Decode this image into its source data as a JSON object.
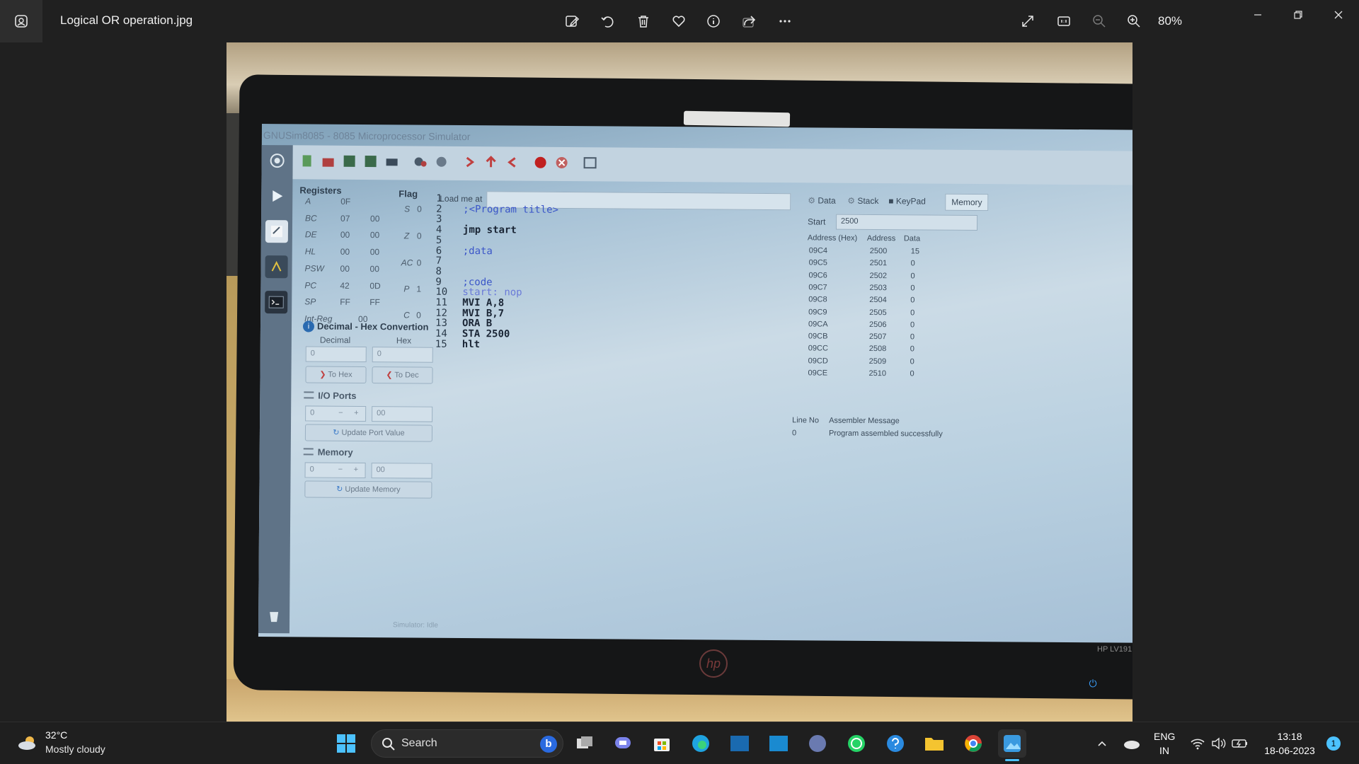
{
  "window": {
    "file_title": "Logical OR operation.jpg",
    "zoom": "80%"
  },
  "colors": {
    "titlebar": "#202020",
    "accent": "#4cc2ff",
    "taskbar": "#1f1f1f"
  },
  "photo": {
    "sim_title": "GNUSim8085 - 8085 Microprocessor Simulator",
    "registers_title": "Registers",
    "flag_title": "Flag",
    "registers": [
      {
        "name": "A",
        "v1": "0F",
        "v2": ""
      },
      {
        "name": "BC",
        "v1": "07",
        "v2": "00"
      },
      {
        "name": "DE",
        "v1": "00",
        "v2": "00"
      },
      {
        "name": "HL",
        "v1": "00",
        "v2": "00"
      },
      {
        "name": "PSW",
        "v1": "00",
        "v2": "00"
      },
      {
        "name": "PC",
        "v1": "42",
        "v2": "0D"
      },
      {
        "name": "SP",
        "v1": "FF",
        "v2": "FF"
      },
      {
        "name": "Int-Reg",
        "v1": "00",
        "v2": ""
      }
    ],
    "flags": [
      {
        "name": "S",
        "value": "0"
      },
      {
        "name": "Z",
        "value": "0"
      },
      {
        "name": "AC",
        "value": "0"
      },
      {
        "name": "P",
        "value": "1"
      },
      {
        "name": "C",
        "value": "0"
      }
    ],
    "converter": {
      "title": "Decimal - Hex Convertion",
      "decimal_label": "Decimal",
      "hex_label": "Hex",
      "decimal_value": "0",
      "hex_value": "0",
      "to_hex": "To Hex",
      "to_dec": "To Dec"
    },
    "io_ports": {
      "title": "I/O Ports",
      "port": "0",
      "value": "00",
      "minus": "−",
      "plus": "+",
      "update": "Update Port Value"
    },
    "memory_box": {
      "title": "Memory",
      "address": "0",
      "value": "00",
      "minus": "−",
      "plus": "+",
      "update": "Update Memory"
    },
    "load_label": "Load me at",
    "code_lines": [
      {
        "n": "1",
        "text": ""
      },
      {
        "n": "2",
        "text": ";<Program title>"
      },
      {
        "n": "3",
        "text": ""
      },
      {
        "n": "4",
        "text": "jmp start"
      },
      {
        "n": "5",
        "text": ""
      },
      {
        "n": "6",
        "text": ";data"
      },
      {
        "n": "7",
        "text": ""
      },
      {
        "n": "8",
        "text": ""
      },
      {
        "n": "9",
        "text": ";code"
      },
      {
        "n": "10",
        "text": "start: nop"
      },
      {
        "n": "11",
        "text": "MVI A,8"
      },
      {
        "n": "12",
        "text": "MVI B,7"
      },
      {
        "n": "13",
        "text": "ORA B"
      },
      {
        "n": "14",
        "text": "STA 2500"
      },
      {
        "n": "15",
        "text": "hlt"
      }
    ],
    "mem_tabs": [
      "Data",
      "Stack",
      "KeyPad",
      "Memory"
    ],
    "start_label": "Start",
    "start_value": "2500",
    "mem_headers": [
      "Address (Hex)",
      "Address",
      "Data"
    ],
    "mem_rows": [
      {
        "hex": "09C4",
        "addr": "2500",
        "data": "15"
      },
      {
        "hex": "09C5",
        "addr": "2501",
        "data": "0"
      },
      {
        "hex": "09C6",
        "addr": "2502",
        "data": "0"
      },
      {
        "hex": "09C7",
        "addr": "2503",
        "data": "0"
      },
      {
        "hex": "09C8",
        "addr": "2504",
        "data": "0"
      },
      {
        "hex": "09C9",
        "addr": "2505",
        "data": "0"
      },
      {
        "hex": "09CA",
        "addr": "2506",
        "data": "0"
      },
      {
        "hex": "09CB",
        "addr": "2507",
        "data": "0"
      },
      {
        "hex": "09CC",
        "addr": "2508",
        "data": "0"
      },
      {
        "hex": "09CD",
        "addr": "2509",
        "data": "0"
      },
      {
        "hex": "09CE",
        "addr": "2510",
        "data": "0"
      }
    ],
    "msg_headers": [
      "Line No",
      "Assembler Message"
    ],
    "msg_line": "0",
    "msg_text": "Program assembled successfully",
    "status": "Simulator: Idle",
    "monitor_model": "HP LV191",
    "brand": "hp"
  },
  "taskbar": {
    "weather_temp": "32°C",
    "weather_desc": "Mostly cloudy",
    "search": "Search",
    "lang": "ENG",
    "region": "IN",
    "time": "13:18",
    "date": "18-06-2023",
    "notifications": "1"
  }
}
